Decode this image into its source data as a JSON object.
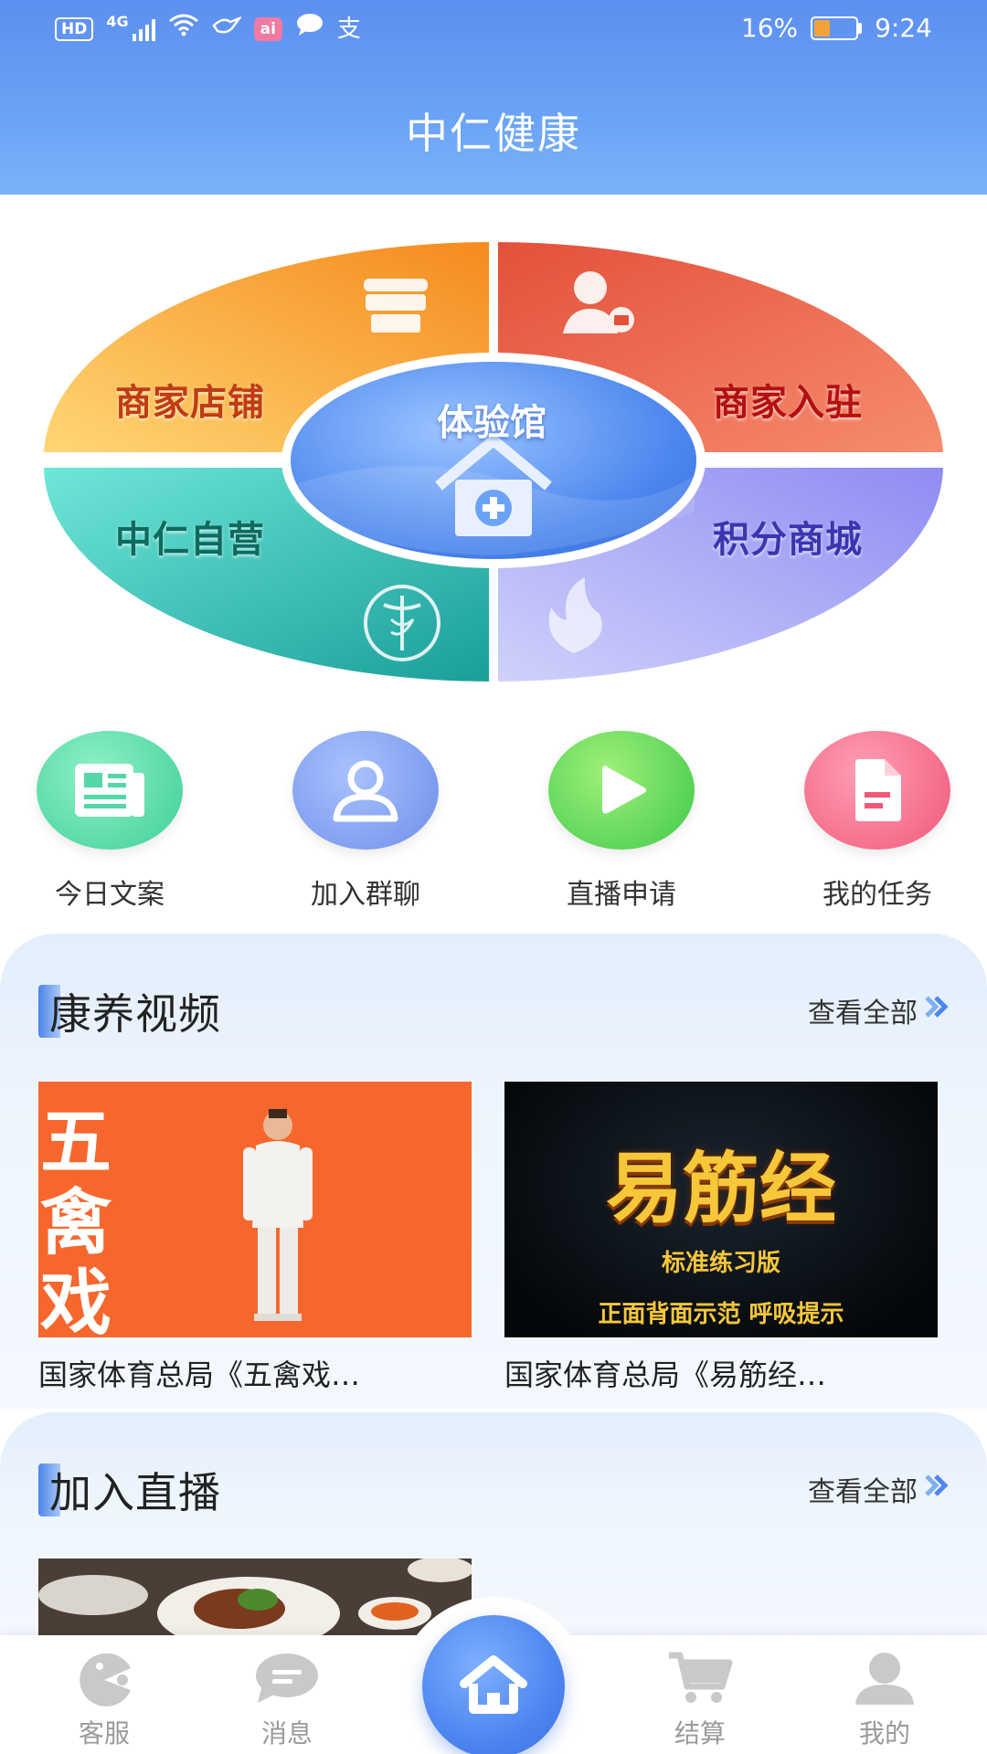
{
  "status_bar": {
    "hd": "HD",
    "network": "4G",
    "ai": "ai",
    "pay": "支",
    "battery_text": "16%",
    "battery_level": 0.16,
    "time": "9:24"
  },
  "header": {
    "title": "中仁健康"
  },
  "ellipse_menu": {
    "center": "体验馆",
    "top_left": "商家店铺",
    "top_right": "商家入驻",
    "bottom_left": "中仁自营",
    "bottom_right": "积分商城"
  },
  "quick_actions": [
    {
      "label": "今日文案",
      "icon": "newspaper-icon"
    },
    {
      "label": "加入群聊",
      "icon": "user-icon"
    },
    {
      "label": "直播申请",
      "icon": "play-icon"
    },
    {
      "label": "我的任务",
      "icon": "document-icon"
    }
  ],
  "sections": {
    "videos": {
      "title": "康养视频",
      "more": "查看全部",
      "items": [
        {
          "title": "国家体育总局《五禽戏…",
          "thumb_text": [
            "五",
            "禽",
            "戏"
          ]
        },
        {
          "title": "国家体育总局《易筋经…",
          "thumb_text": [
            "易筋经",
            "标准练习版",
            "正面背面示范 呼吸提示"
          ]
        }
      ]
    },
    "live": {
      "title": "加入直播",
      "more": "查看全部"
    }
  },
  "bottom_nav": {
    "items": [
      {
        "label": "客服",
        "icon": "customer-service-icon"
      },
      {
        "label": "消息",
        "icon": "message-icon"
      },
      {
        "label": "",
        "icon": "home-icon"
      },
      {
        "label": "结算",
        "icon": "cart-icon"
      },
      {
        "label": "我的",
        "icon": "profile-icon"
      }
    ]
  },
  "colors": {
    "header": "#5d8ff0",
    "accent": "#4d86f0",
    "top_left_label": "#c03c12",
    "top_right_label": "#b41010",
    "bottom_left_label": "#0f6a5f",
    "bottom_right_label": "#3a35b0"
  }
}
